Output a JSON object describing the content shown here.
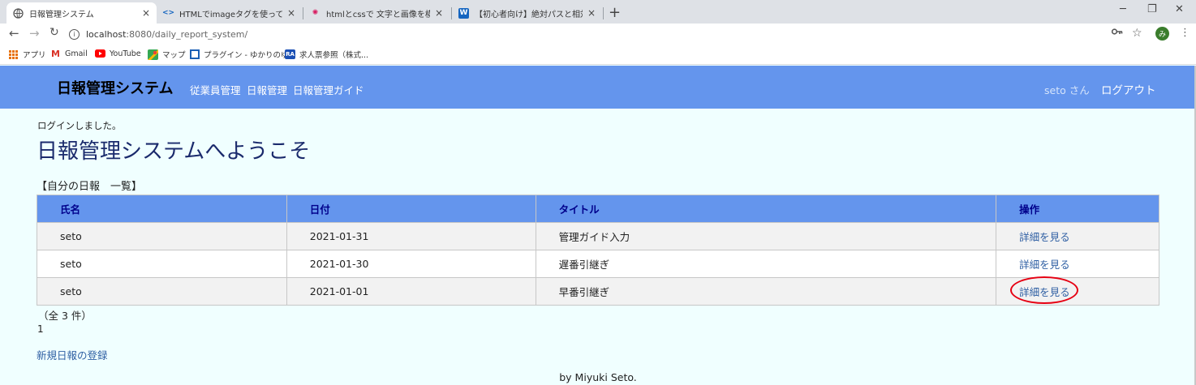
{
  "browser": {
    "tabs": [
      {
        "title": "日報管理システム",
        "icon": "globe-icon"
      },
      {
        "title": "HTMLでimageタグを使って画像を表",
        "icon": "code-icon"
      },
      {
        "title": "htmlとcssで 文字と画像を横に並べ",
        "icon": "sparkle-icon"
      },
      {
        "title": "【初心者向け】絶対パスと相対パスの",
        "icon": "w-icon"
      }
    ],
    "tab_close": "×",
    "new_tab": "+",
    "url_host": "localhost",
    "url_rest": ":8080/daily_report_system/",
    "profile_initial": "み",
    "bookmarks": [
      {
        "label": "アプリ",
        "icon": "apps-grid-icon"
      },
      {
        "label": "Gmail",
        "icon": "gmail-icon"
      },
      {
        "label": "YouTube",
        "icon": "youtube-icon"
      },
      {
        "label": "マップ",
        "icon": "maps-icon"
      },
      {
        "label": "プラグイン - ゆかりのゆ...",
        "icon": "bookmark-page-icon"
      },
      {
        "label": "求人票参照（株式...",
        "icon": "ra-icon"
      }
    ]
  },
  "app": {
    "title": "日報管理システム",
    "nav": [
      "従業員管理",
      "日報管理",
      "日報管理ガイド"
    ],
    "user": "seto さん",
    "logout": "ログアウト",
    "brand_color": "#6495ed"
  },
  "content": {
    "flash": "ログインしました。",
    "welcome": "日報管理システムへようこそ",
    "list_title": "【自分の日報　一覧】",
    "columns": [
      "氏名",
      "日付",
      "タイトル",
      "操作"
    ],
    "rows": [
      {
        "name": "seto",
        "date": "2021-01-31",
        "title": "管理ガイド入力",
        "action": "詳細を見る"
      },
      {
        "name": "seto",
        "date": "2021-01-30",
        "title": "遅番引継ぎ",
        "action": "詳細を見る"
      },
      {
        "name": "seto",
        "date": "2021-01-01",
        "title": "早番引継ぎ",
        "action": "詳細を見る"
      }
    ],
    "count": "（全 3 件）",
    "page": "1",
    "new_link": "新規日報の登録",
    "footer": "by Miyuki Seto."
  }
}
